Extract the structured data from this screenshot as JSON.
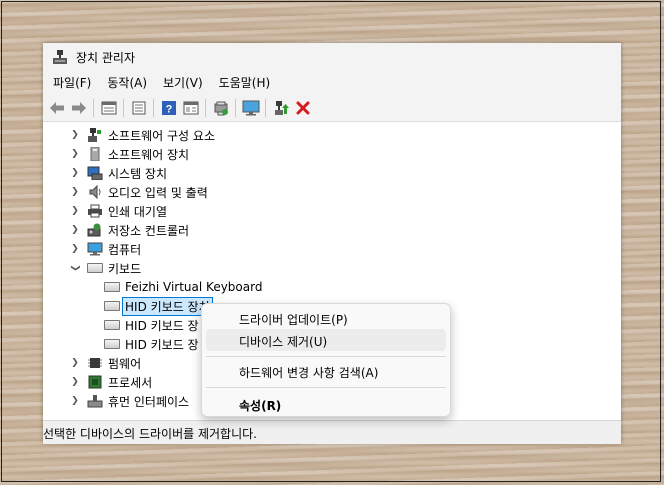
{
  "window": {
    "title": "장치 관리자"
  },
  "menu": [
    "파일(F)",
    "동작(A)",
    "보기(V)",
    "도움말(H)"
  ],
  "toolbar": {
    "icons": [
      "back-arrow-icon",
      "forward-arrow-icon",
      "properties-icon",
      "view-icon",
      "help-icon",
      "details-icon",
      "scan-hardware-icon",
      "monitor-icon",
      "enable-device-icon",
      "uninstall-x-icon"
    ]
  },
  "tree": {
    "categories_top": [
      {
        "label": "소프트웨어 구성 요소",
        "icon": "software-component-icon"
      },
      {
        "label": "소프트웨어 장치",
        "icon": "software-device-icon"
      },
      {
        "label": "시스템 장치",
        "icon": "system-device-icon"
      },
      {
        "label": "오디오 입력 및 출력",
        "icon": "speaker-icon"
      },
      {
        "label": "인쇄 대기열",
        "icon": "printer-icon"
      },
      {
        "label": "저장소 컨트롤러",
        "icon": "storage-controller-icon"
      },
      {
        "label": "컴퓨터",
        "icon": "computer-icon"
      }
    ],
    "keyboard_category": {
      "label": "키보드",
      "icon": "keyboard-icon"
    },
    "keyboard_children": [
      {
        "label": "Feizhi Virtual Keyboard"
      },
      {
        "label": "HID 키보드 장치",
        "selected": true
      },
      {
        "label": "HID 키보드 장"
      },
      {
        "label": "HID 키보드 장"
      }
    ],
    "categories_bottom": [
      {
        "label": "펌웨어",
        "icon": "firmware-icon"
      },
      {
        "label": "프로세서",
        "icon": "processor-icon"
      },
      {
        "label": "휴먼 인터페이스",
        "icon": "hid-icon"
      }
    ]
  },
  "context_menu": {
    "update_driver": "드라이버 업데이트(P)",
    "uninstall_device": "디바이스 제거(U)",
    "scan_hardware": "하드웨어 변경 사항 검색(A)",
    "properties": "속성(R)"
  },
  "status": {
    "text": "선택한 디바이스의 드라이버를 제거합니다."
  },
  "colors": {
    "selection_bg": "#cce8ff",
    "selection_border": "#0078d7",
    "remove_red": "#d6191b"
  }
}
